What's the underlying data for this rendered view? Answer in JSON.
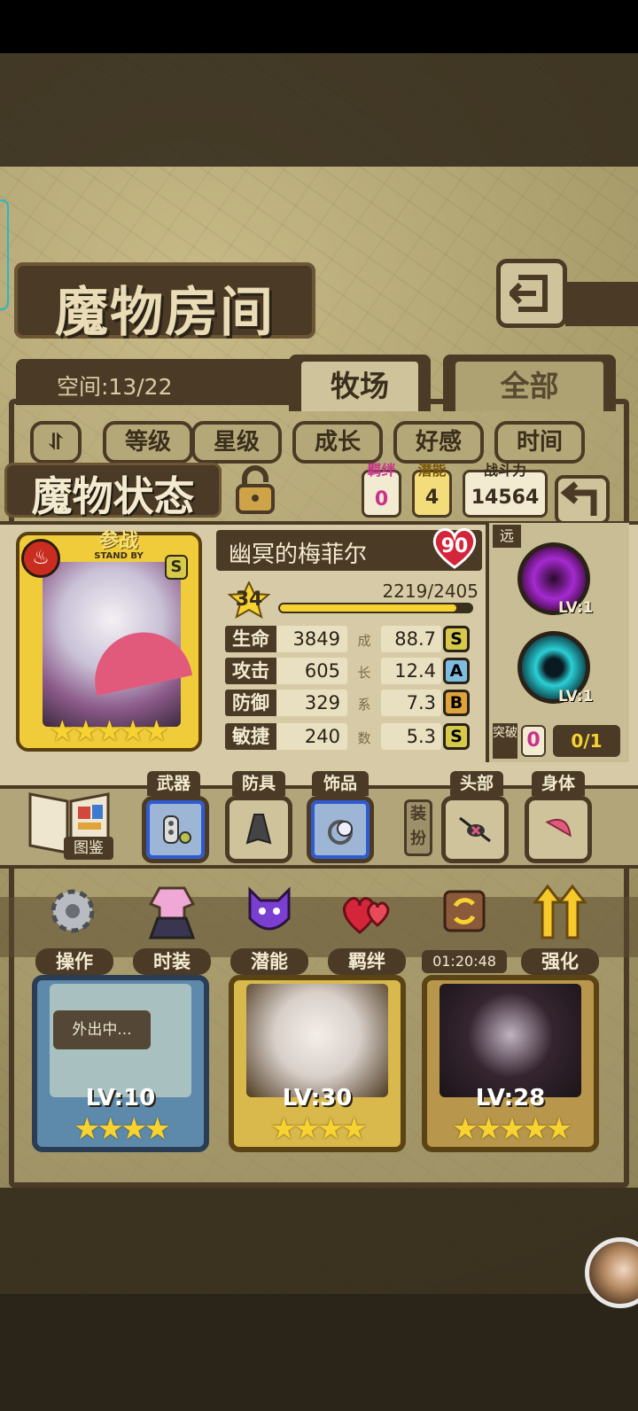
{
  "room": {
    "title": "魔物房间",
    "space": "空间:13/22"
  },
  "tabs": [
    {
      "label": "牧场"
    },
    {
      "label": "全部"
    }
  ],
  "sort": {
    "toggle": "⥯",
    "options": [
      "等级",
      "星级",
      "成长",
      "好感",
      "时间"
    ]
  },
  "status": {
    "title": "魔物状态",
    "bond": {
      "label": "羁绊",
      "value": "0"
    },
    "potential": {
      "label": "潜能",
      "value": "4"
    },
    "power": {
      "label": "战斗力",
      "value": "14564"
    }
  },
  "monster": {
    "name": "幽冥的梅菲尔",
    "affection": "90",
    "standby_cn": "参战",
    "standby_en": "STAND BY",
    "grade": "S",
    "stars": "★★★★★",
    "level": "34",
    "exp_text": "2219/2405",
    "exp_fraction": 0.923,
    "stats": [
      {
        "label": "生命",
        "value": "3849",
        "growth": "88.7",
        "grade": "S"
      },
      {
        "label": "攻击",
        "value": "605",
        "growth": "12.4",
        "grade": "A"
      },
      {
        "label": "防御",
        "value": "329",
        "growth": "7.3",
        "grade": "B"
      },
      {
        "label": "敏捷",
        "value": "240",
        "growth": "5.3",
        "grade": "S"
      }
    ],
    "growth_caption": [
      "成",
      "长",
      "系",
      "数"
    ]
  },
  "skills": {
    "range": "远",
    "items": [
      {
        "level": "LV:1"
      },
      {
        "level": "LV:1"
      }
    ],
    "breakthrough": {
      "label": "突破",
      "count": "0",
      "fraction": "0/1"
    }
  },
  "equipment": {
    "book_label": "图鉴",
    "weapon": "武器",
    "armor": "防具",
    "accessory": "饰品",
    "dress_tag": "装扮",
    "head": "头部",
    "body": "身体"
  },
  "actions": [
    {
      "label": "操作"
    },
    {
      "label": "时装"
    },
    {
      "label": "潜能"
    },
    {
      "label": "羁绊"
    },
    {
      "time": "01:20:48"
    },
    {
      "label": "强化"
    }
  ],
  "cards": [
    {
      "level": "LV:10",
      "stars": "★★★★",
      "status": "外出中..."
    },
    {
      "level": "LV:30",
      "stars": "★★★★"
    },
    {
      "level": "LV:28",
      "stars": "★★★★★"
    }
  ],
  "colors": {
    "frame": "#4b3b26",
    "parchment": "#d6cba6",
    "gold": "#f7d331",
    "pink": "#c8328d"
  }
}
